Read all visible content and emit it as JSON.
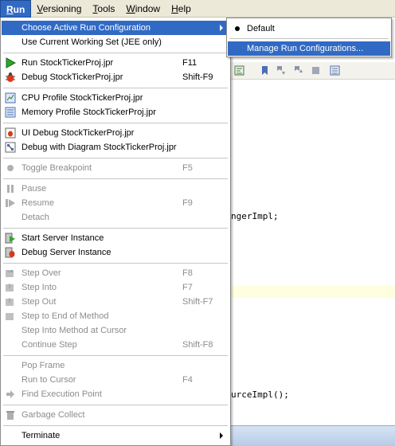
{
  "menubar": {
    "items": [
      "Run",
      "Versioning",
      "Tools",
      "Window",
      "Help"
    ]
  },
  "code": {
    "line1": "ngerImpl;",
    "line2": "urceImpl();"
  },
  "run_menu": {
    "choose_config": "Choose Active Run Configuration",
    "use_working_set": "Use Current Working Set (JEE only)",
    "run": {
      "label": "Run StockTickerProj.jpr",
      "shortcut": "F11"
    },
    "debug": {
      "label": "Debug StockTickerProj.jpr",
      "shortcut": "Shift-F9"
    },
    "cpu_profile": "CPU Profile StockTickerProj.jpr",
    "memory_profile": "Memory Profile StockTickerProj.jpr",
    "ui_debug": "UI Debug StockTickerProj.jpr",
    "debug_diagram": "Debug with Diagram StockTickerProj.jpr",
    "toggle_breakpoint": {
      "label": "Toggle Breakpoint",
      "shortcut": "F5"
    },
    "pause": "Pause",
    "resume": {
      "label": "Resume",
      "shortcut": "F9"
    },
    "detach": "Detach",
    "start_server": "Start Server Instance",
    "debug_server": "Debug Server Instance",
    "step_over": {
      "label": "Step Over",
      "shortcut": "F8"
    },
    "step_into": {
      "label": "Step Into",
      "shortcut": "F7"
    },
    "step_out": {
      "label": "Step Out",
      "shortcut": "Shift-F7"
    },
    "step_end": "Step to End of Method",
    "step_into_cursor": "Step Into Method at Cursor",
    "continue_step": {
      "label": "Continue Step",
      "shortcut": "Shift-F8"
    },
    "pop_frame": "Pop Frame",
    "run_to_cursor": {
      "label": "Run to Cursor",
      "shortcut": "F4"
    },
    "find_exec_point": "Find Execution Point",
    "garbage_collect": "Garbage Collect",
    "terminate": "Terminate"
  },
  "submenu": {
    "default": "Default",
    "manage": "Manage Run Configurations..."
  },
  "colors": {
    "selection": "#316ac5",
    "menubar_bg": "#ece9d8",
    "disabled_text": "#8c8c8c"
  }
}
